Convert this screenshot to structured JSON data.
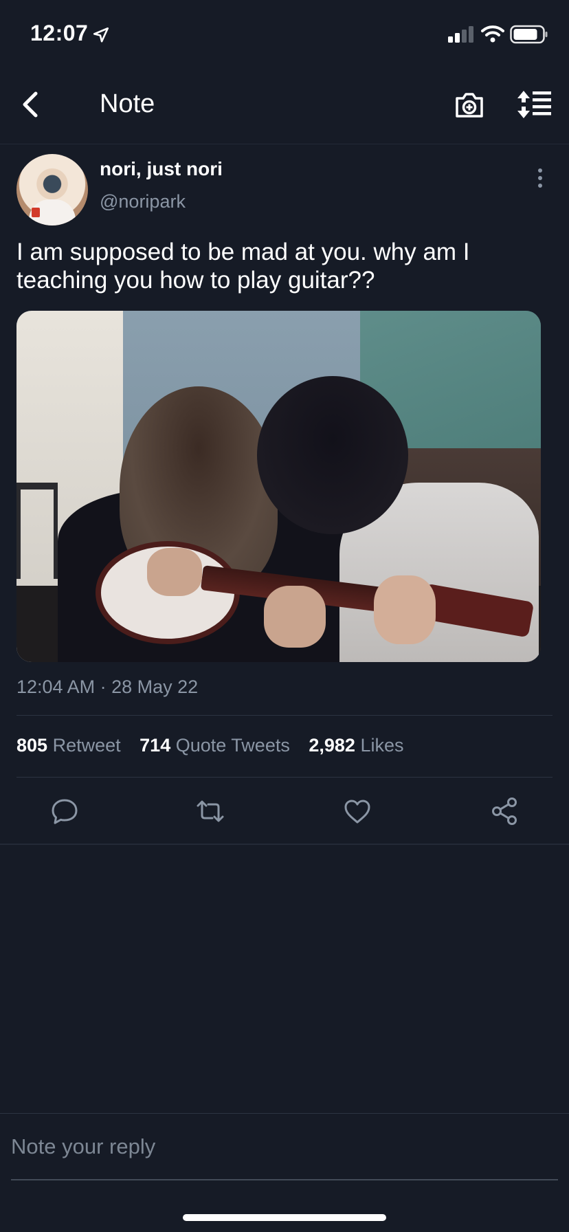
{
  "status_bar": {
    "time": "12:07",
    "icons": [
      "location-arrow-icon",
      "cellular-signal-icon",
      "wifi-icon",
      "battery-icon"
    ]
  },
  "nav": {
    "title": "Note",
    "icons": [
      "back-chevron-icon",
      "camera-plus-icon",
      "sort-order-icon"
    ]
  },
  "tweet": {
    "display_name": "nori, just nori",
    "handle": "@noripark",
    "text": "I am supposed to be mad at you. why  am I teaching you how to play guitar??",
    "timestamp": "12:04 AM · 28 May 22",
    "stats": {
      "retweets_count": "805",
      "retweets_label": "Retweet",
      "quotes_count": "714",
      "quotes_label": "Quote Tweets",
      "likes_count": "2,982",
      "likes_label": "Likes"
    },
    "actions": [
      "reply-icon",
      "retweet-icon",
      "like-icon",
      "share-icon"
    ]
  },
  "composer": {
    "placeholder": "Note your reply",
    "value": ""
  },
  "colors": {
    "background": "#161b26",
    "secondary_text": "#8b96a5",
    "divider": "#2c3442"
  }
}
